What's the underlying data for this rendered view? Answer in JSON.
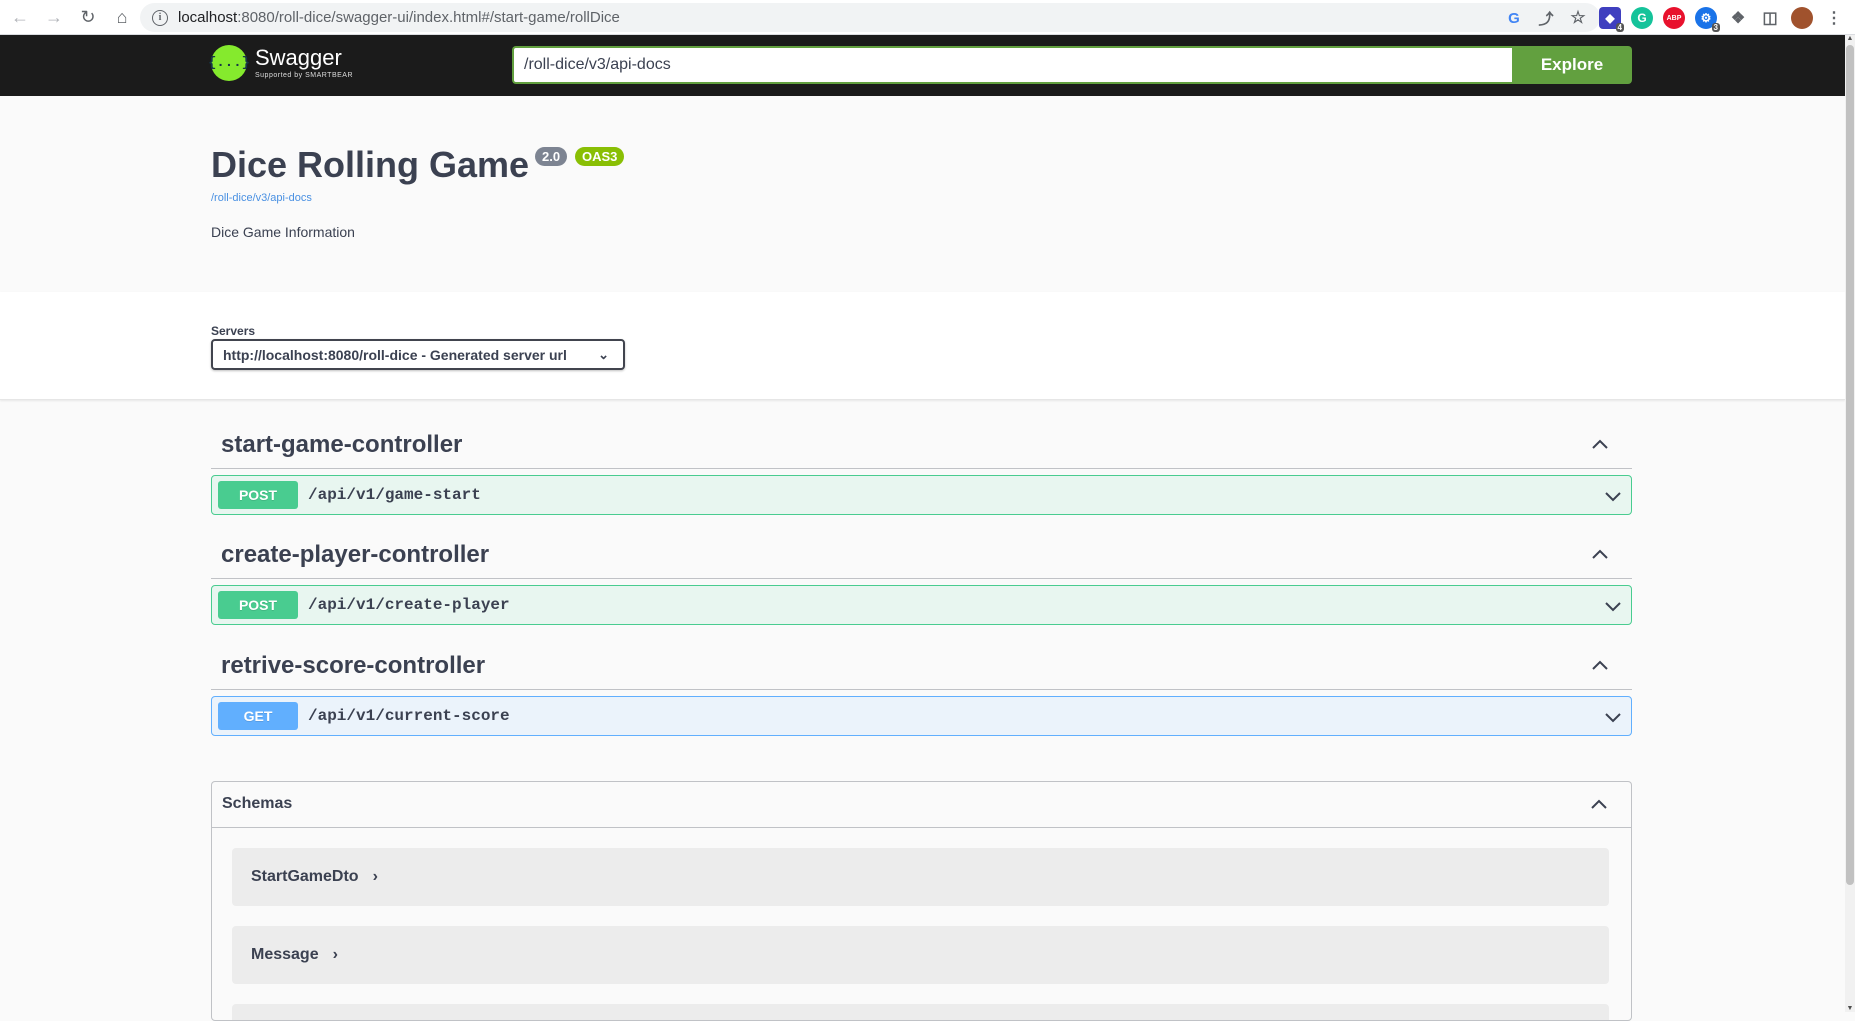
{
  "browser": {
    "url_host": "localhost",
    "url_path": ":8080/roll-dice/swagger-ui/index.html#/start-game/rollDice",
    "ext_badge_1": "4",
    "ext_abp": "ABP",
    "ext_badge_2": "3"
  },
  "topbar": {
    "logo_symbol": "{...}",
    "logo_name": "Swagger",
    "logo_tagline": "Supported by SMARTBEAR",
    "spec_url": "/roll-dice/v3/api-docs",
    "explore_label": "Explore"
  },
  "info": {
    "title": "Dice Rolling Game",
    "version": "2.0",
    "oas": "OAS3",
    "spec_link": "/roll-dice/v3/api-docs",
    "description": "Dice Game Information"
  },
  "servers": {
    "label": "Servers",
    "selected": "http://localhost:8080/roll-dice - Generated server url"
  },
  "tags": [
    {
      "name": "start-game-controller",
      "op": {
        "method": "POST",
        "path": "/api/v1/game-start"
      }
    },
    {
      "name": "create-player-controller",
      "op": {
        "method": "POST",
        "path": "/api/v1/create-player"
      }
    },
    {
      "name": "retrive-score-controller",
      "op": {
        "method": "GET",
        "path": "/api/v1/current-score"
      }
    }
  ],
  "schemas": {
    "title": "Schemas",
    "models": [
      "StartGameDto",
      "Message"
    ]
  },
  "colors": {
    "post": "#49cc90",
    "get": "#61affe",
    "topbar": "#1b1b1b",
    "explore": "#62a03f"
  }
}
